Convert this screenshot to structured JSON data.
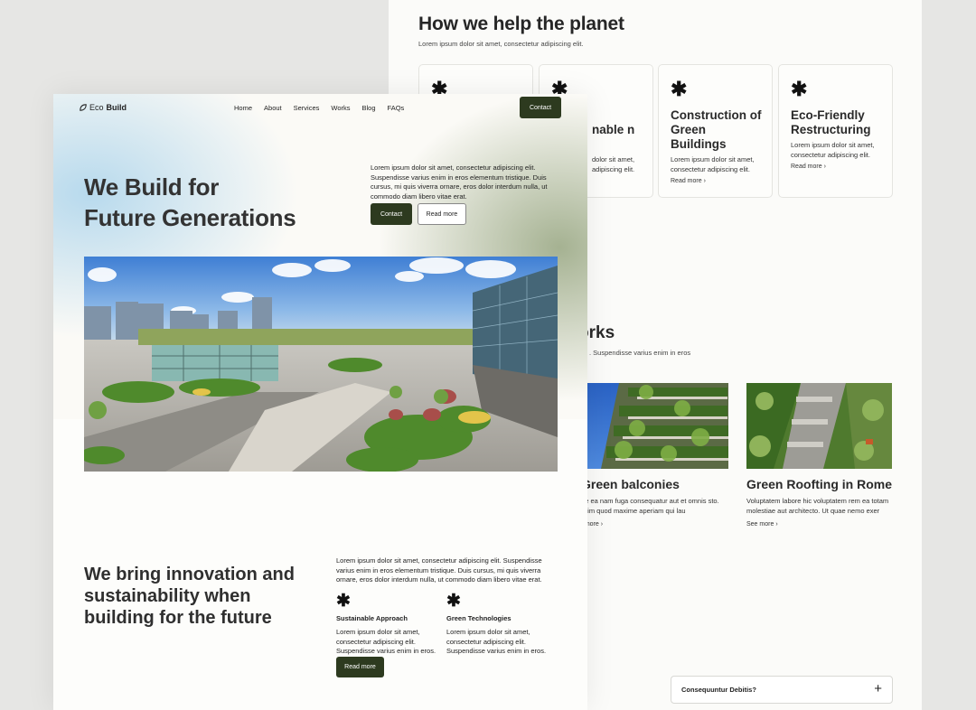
{
  "back_page": {
    "title": "How we help the planet",
    "subtitle": "Lorem ipsum dolor sit amet, consectetur adipiscing elit.",
    "cards": [
      {
        "title": "",
        "text": "",
        "link": ""
      },
      {
        "title": "nable n",
        "text": "dolor sit amet, adipiscing elit.",
        "link": ""
      },
      {
        "title": "Construction of Green Buildings",
        "text": "Lorem ipsum dolor sit amet, consectetur adipiscing elit.",
        "link": "Read more"
      },
      {
        "title": "Eco-Friendly Restructuring",
        "text": "Lorem ipsum dolor sit amet, consectetur adipiscing elit.",
        "link": "Read more"
      }
    ],
    "works_title": "orks",
    "works_subtitle": ". Suspendisse varius enim in eros",
    "works": [
      {
        "title": "Green balconies",
        "text": "tae ea nam fuga consequatur aut et omnis sto. Enim quod maxime aperiam qui lau",
        "link": "e more"
      },
      {
        "title": "Green Roofting in Rome",
        "text": "Voluptatem labore hic voluptatem rem ea totam molestiae aut architecto. Ut quae nemo exer",
        "link": "See more"
      }
    ],
    "faq_question": "Consequuntur Debitis?"
  },
  "front_page": {
    "logo_prefix": "Eco",
    "logo_bold": "Build",
    "nav": [
      "Home",
      "About",
      "Services",
      "Works",
      "Blog",
      "FAQs"
    ],
    "nav_contact": "Contact",
    "hero_title_line1": "We Build for",
    "hero_title_line2": "Future Generations",
    "hero_text": "Lorem ipsum dolor sit amet, consectetur adipiscing elit. Suspendisse varius enim in eros elementum tristique. Duis cursus, mi quis viverra ornare, eros dolor interdum nulla, ut commodo diam libero vitae erat.",
    "hero_contact": "Contact",
    "hero_read_more": "Read more",
    "section_title": "We bring innovation and sustainability when building for the future",
    "section_text": "Lorem ipsum dolor sit amet, consectetur adipiscing elit. Suspendisse varius enim in eros elementum tristique. Duis cursus, mi quis viverra ornare, eros dolor interdum nulla, ut commodo diam libero vitae erat.",
    "features": [
      {
        "title": "Sustainable Approach",
        "text": "Lorem ipsum dolor sit amet, consectetur adipiscing elit. Suspendisse varius enim in eros."
      },
      {
        "title": "Green Technologies",
        "text": "Lorem ipsum dolor sit amet, consectetur adipiscing elit. Suspendisse varius enim in eros."
      }
    ],
    "section_button": "Read more"
  },
  "colors": {
    "dark_green": "#2d3a1f",
    "background": "#e6e6e4",
    "page": "#fdfdfb"
  },
  "icons": [
    "asterisk-icon",
    "chevron-right-icon",
    "plus-icon",
    "logo-leaf-icon"
  ]
}
